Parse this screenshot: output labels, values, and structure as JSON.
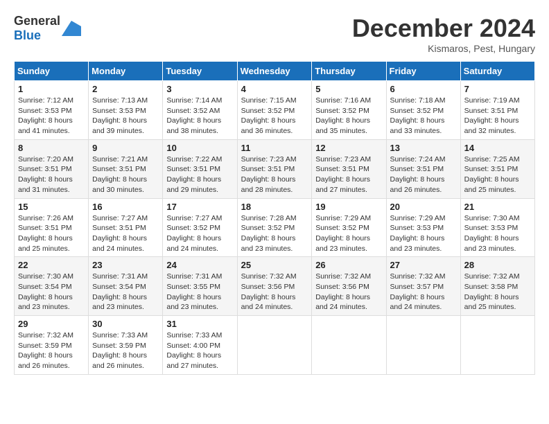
{
  "header": {
    "logo_general": "General",
    "logo_blue": "Blue",
    "month": "December 2024",
    "location": "Kismaros, Pest, Hungary"
  },
  "days_of_week": [
    "Sunday",
    "Monday",
    "Tuesday",
    "Wednesday",
    "Thursday",
    "Friday",
    "Saturday"
  ],
  "weeks": [
    [
      {
        "day": "1",
        "info": "Sunrise: 7:12 AM\nSunset: 3:53 PM\nDaylight: 8 hours\nand 41 minutes."
      },
      {
        "day": "2",
        "info": "Sunrise: 7:13 AM\nSunset: 3:53 PM\nDaylight: 8 hours\nand 39 minutes."
      },
      {
        "day": "3",
        "info": "Sunrise: 7:14 AM\nSunset: 3:52 AM\nDaylight: 8 hours\nand 38 minutes."
      },
      {
        "day": "4",
        "info": "Sunrise: 7:15 AM\nSunset: 3:52 PM\nDaylight: 8 hours\nand 36 minutes."
      },
      {
        "day": "5",
        "info": "Sunrise: 7:16 AM\nSunset: 3:52 PM\nDaylight: 8 hours\nand 35 minutes."
      },
      {
        "day": "6",
        "info": "Sunrise: 7:18 AM\nSunset: 3:52 PM\nDaylight: 8 hours\nand 33 minutes."
      },
      {
        "day": "7",
        "info": "Sunrise: 7:19 AM\nSunset: 3:51 PM\nDaylight: 8 hours\nand 32 minutes."
      }
    ],
    [
      {
        "day": "8",
        "info": "Sunrise: 7:20 AM\nSunset: 3:51 PM\nDaylight: 8 hours\nand 31 minutes."
      },
      {
        "day": "9",
        "info": "Sunrise: 7:21 AM\nSunset: 3:51 PM\nDaylight: 8 hours\nand 30 minutes."
      },
      {
        "day": "10",
        "info": "Sunrise: 7:22 AM\nSunset: 3:51 PM\nDaylight: 8 hours\nand 29 minutes."
      },
      {
        "day": "11",
        "info": "Sunrise: 7:23 AM\nSunset: 3:51 PM\nDaylight: 8 hours\nand 28 minutes."
      },
      {
        "day": "12",
        "info": "Sunrise: 7:23 AM\nSunset: 3:51 PM\nDaylight: 8 hours\nand 27 minutes."
      },
      {
        "day": "13",
        "info": "Sunrise: 7:24 AM\nSunset: 3:51 PM\nDaylight: 8 hours\nand 26 minutes."
      },
      {
        "day": "14",
        "info": "Sunrise: 7:25 AM\nSunset: 3:51 PM\nDaylight: 8 hours\nand 25 minutes."
      }
    ],
    [
      {
        "day": "15",
        "info": "Sunrise: 7:26 AM\nSunset: 3:51 PM\nDaylight: 8 hours\nand 25 minutes."
      },
      {
        "day": "16",
        "info": "Sunrise: 7:27 AM\nSunset: 3:51 PM\nDaylight: 8 hours\nand 24 minutes."
      },
      {
        "day": "17",
        "info": "Sunrise: 7:27 AM\nSunset: 3:52 PM\nDaylight: 8 hours\nand 24 minutes."
      },
      {
        "day": "18",
        "info": "Sunrise: 7:28 AM\nSunset: 3:52 PM\nDaylight: 8 hours\nand 23 minutes."
      },
      {
        "day": "19",
        "info": "Sunrise: 7:29 AM\nSunset: 3:52 PM\nDaylight: 8 hours\nand 23 minutes."
      },
      {
        "day": "20",
        "info": "Sunrise: 7:29 AM\nSunset: 3:53 PM\nDaylight: 8 hours\nand 23 minutes."
      },
      {
        "day": "21",
        "info": "Sunrise: 7:30 AM\nSunset: 3:53 PM\nDaylight: 8 hours\nand 23 minutes."
      }
    ],
    [
      {
        "day": "22",
        "info": "Sunrise: 7:30 AM\nSunset: 3:54 PM\nDaylight: 8 hours\nand 23 minutes."
      },
      {
        "day": "23",
        "info": "Sunrise: 7:31 AM\nSunset: 3:54 PM\nDaylight: 8 hours\nand 23 minutes."
      },
      {
        "day": "24",
        "info": "Sunrise: 7:31 AM\nSunset: 3:55 PM\nDaylight: 8 hours\nand 23 minutes."
      },
      {
        "day": "25",
        "info": "Sunrise: 7:32 AM\nSunset: 3:56 PM\nDaylight: 8 hours\nand 24 minutes."
      },
      {
        "day": "26",
        "info": "Sunrise: 7:32 AM\nSunset: 3:56 PM\nDaylight: 8 hours\nand 24 minutes."
      },
      {
        "day": "27",
        "info": "Sunrise: 7:32 AM\nSunset: 3:57 PM\nDaylight: 8 hours\nand 24 minutes."
      },
      {
        "day": "28",
        "info": "Sunrise: 7:32 AM\nSunset: 3:58 PM\nDaylight: 8 hours\nand 25 minutes."
      }
    ],
    [
      {
        "day": "29",
        "info": "Sunrise: 7:32 AM\nSunset: 3:59 PM\nDaylight: 8 hours\nand 26 minutes."
      },
      {
        "day": "30",
        "info": "Sunrise: 7:33 AM\nSunset: 3:59 PM\nDaylight: 8 hours\nand 26 minutes."
      },
      {
        "day": "31",
        "info": "Sunrise: 7:33 AM\nSunset: 4:00 PM\nDaylight: 8 hours\nand 27 minutes."
      },
      {
        "day": "",
        "info": ""
      },
      {
        "day": "",
        "info": ""
      },
      {
        "day": "",
        "info": ""
      },
      {
        "day": "",
        "info": ""
      }
    ]
  ]
}
